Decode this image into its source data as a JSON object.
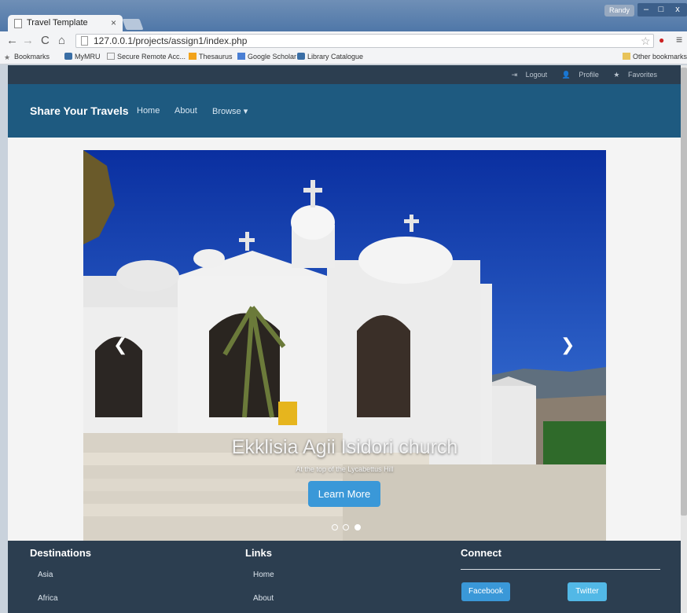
{
  "browser": {
    "tab_title": "Travel Template",
    "tab_close": "×",
    "user_chip": "Randy",
    "win_min": "–",
    "win_max": "□",
    "win_close": "x",
    "url": "127.0.0.1/projects/assign1/index.php",
    "bookmarks": [
      {
        "label": "Bookmarks",
        "icon": "star-icon"
      },
      {
        "label": "MyMRU",
        "icon": "mru-icon"
      },
      {
        "label": "Secure Remote Acc...",
        "icon": "page-icon"
      },
      {
        "label": "Thesaurus",
        "icon": "thesaurus-icon"
      },
      {
        "label": "Google Scholar",
        "icon": "scholar-icon"
      },
      {
        "label": "Library Catalogue",
        "icon": "mru-icon"
      }
    ],
    "other_bookmarks": "Other bookmarks"
  },
  "topbar": {
    "logout": "Logout",
    "profile": "Profile",
    "favorites": "Favorites"
  },
  "navbar": {
    "brand": "Share Your Travels",
    "links": [
      "Home",
      "About",
      "Browse"
    ]
  },
  "carousel": {
    "caption_title": "Ekklisia Agii Isidori church",
    "caption_sub": "At the top of the Lycabettus Hill",
    "button": "Learn More",
    "slides_total": 3,
    "active_slide": 3
  },
  "footer": {
    "destinations_heading": "Destinations",
    "destinations": [
      "Asia",
      "Africa"
    ],
    "links_heading": "Links",
    "links": [
      "Home",
      "About"
    ],
    "connect_heading": "Connect",
    "facebook": "Facebook",
    "twitter": "Twitter"
  },
  "colors": {
    "navbar": "#1e5a80",
    "topbar": "#2c3e50",
    "primary_button": "#3a98d8",
    "twitter_button": "#52b8e6"
  }
}
